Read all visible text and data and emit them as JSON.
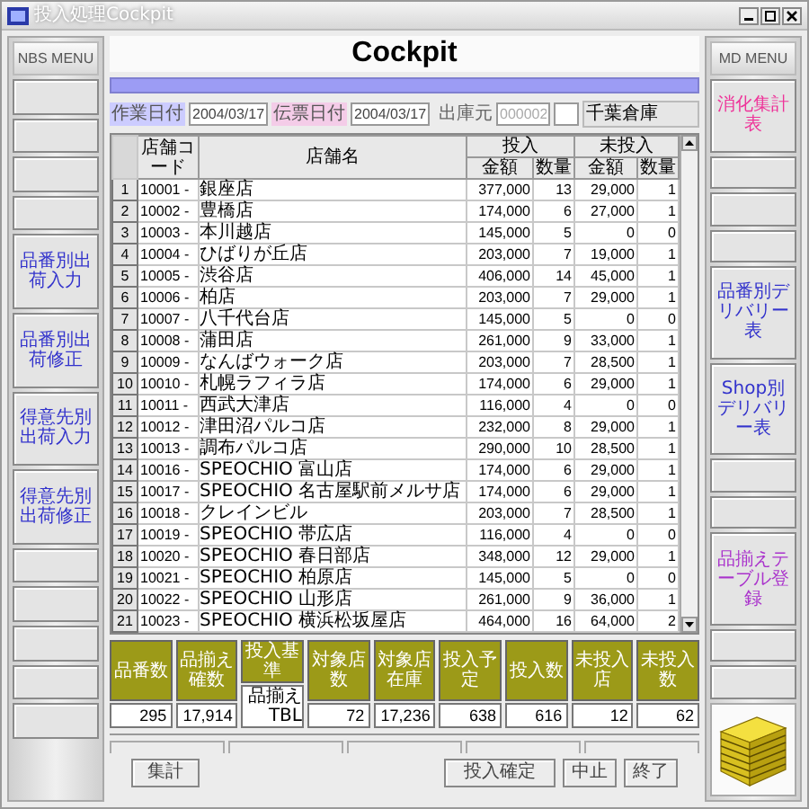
{
  "window": {
    "title": "投入処理Cockpit"
  },
  "left_menu": {
    "title": "NBS MENU",
    "items": [
      {
        "kind": "blank"
      },
      {
        "kind": "blank"
      },
      {
        "kind": "blank"
      },
      {
        "kind": "blank"
      },
      {
        "kind": "command",
        "label": "品番別出荷入力",
        "color": "#3333cc"
      },
      {
        "kind": "command",
        "label": "品番別出荷修正",
        "color": "#3333cc"
      },
      {
        "kind": "command",
        "label": "得意先別出荷入力",
        "color": "#3333cc"
      },
      {
        "kind": "command",
        "label": "得意先別出荷修正",
        "color": "#3333cc"
      },
      {
        "kind": "blank"
      },
      {
        "kind": "blank"
      },
      {
        "kind": "blank"
      },
      {
        "kind": "blank"
      },
      {
        "kind": "blank"
      }
    ]
  },
  "header": {
    "title": "Cockpit"
  },
  "fields": {
    "work_date_label": "作業日付",
    "work_date": "2004/03/17",
    "slip_date_label": "伝票日付",
    "slip_date": "2004/03/17",
    "source_label": "出庫元",
    "source_placeholder": "000002",
    "warehouse": "千葉倉庫"
  },
  "table": {
    "columns": {
      "code": "店舗コード",
      "name": "店舗名",
      "in_group": "投入",
      "out_group": "未投入",
      "in_amount": "金額",
      "in_qty": "数量",
      "out_amount": "金額",
      "out_qty": "数量"
    },
    "rows": [
      {
        "no": "1",
        "code": "10001 -",
        "name": "銀座店",
        "in_amount": "377,000",
        "in_qty": "13",
        "out_amount": "29,000",
        "out_qty": "1"
      },
      {
        "no": "2",
        "code": "10002 -",
        "name": "豊橋店",
        "in_amount": "174,000",
        "in_qty": "6",
        "out_amount": "27,000",
        "out_qty": "1"
      },
      {
        "no": "3",
        "code": "10003 -",
        "name": "本川越店",
        "in_amount": "145,000",
        "in_qty": "5",
        "out_amount": "0",
        "out_qty": "0"
      },
      {
        "no": "4",
        "code": "10004 -",
        "name": "ひばりが丘店",
        "in_amount": "203,000",
        "in_qty": "7",
        "out_amount": "19,000",
        "out_qty": "1"
      },
      {
        "no": "5",
        "code": "10005 -",
        "name": "渋谷店",
        "in_amount": "406,000",
        "in_qty": "14",
        "out_amount": "45,000",
        "out_qty": "1"
      },
      {
        "no": "6",
        "code": "10006 -",
        "name": "柏店",
        "in_amount": "203,000",
        "in_qty": "7",
        "out_amount": "29,000",
        "out_qty": "1"
      },
      {
        "no": "7",
        "code": "10007 -",
        "name": "八千代台店",
        "in_amount": "145,000",
        "in_qty": "5",
        "out_amount": "0",
        "out_qty": "0"
      },
      {
        "no": "8",
        "code": "10008 -",
        "name": "蒲田店",
        "in_amount": "261,000",
        "in_qty": "9",
        "out_amount": "33,000",
        "out_qty": "1"
      },
      {
        "no": "9",
        "code": "10009 -",
        "name": "なんばウォーク店",
        "in_amount": "203,000",
        "in_qty": "7",
        "out_amount": "28,500",
        "out_qty": "1"
      },
      {
        "no": "10",
        "code": "10010 -",
        "name": "札幌ラフィラ店",
        "in_amount": "174,000",
        "in_qty": "6",
        "out_amount": "29,000",
        "out_qty": "1"
      },
      {
        "no": "11",
        "code": "10011 -",
        "name": "西武大津店",
        "in_amount": "116,000",
        "in_qty": "4",
        "out_amount": "0",
        "out_qty": "0"
      },
      {
        "no": "12",
        "code": "10012 -",
        "name": "津田沼パルコ店",
        "in_amount": "232,000",
        "in_qty": "8",
        "out_amount": "29,000",
        "out_qty": "1"
      },
      {
        "no": "13",
        "code": "10013 -",
        "name": "調布パルコ店",
        "in_amount": "290,000",
        "in_qty": "10",
        "out_amount": "28,500",
        "out_qty": "1"
      },
      {
        "no": "14",
        "code": "10016 -",
        "name": "SPEOCHIO 富山店",
        "in_amount": "174,000",
        "in_qty": "6",
        "out_amount": "29,000",
        "out_qty": "1"
      },
      {
        "no": "15",
        "code": "10017 -",
        "name": "SPEOCHIO 名古屋駅前メルサ店",
        "in_amount": "174,000",
        "in_qty": "6",
        "out_amount": "29,000",
        "out_qty": "1"
      },
      {
        "no": "16",
        "code": "10018 -",
        "name": "クレインビル",
        "in_amount": "203,000",
        "in_qty": "7",
        "out_amount": "28,500",
        "out_qty": "1"
      },
      {
        "no": "17",
        "code": "10019 -",
        "name": "SPEOCHIO 帯広店",
        "in_amount": "116,000",
        "in_qty": "4",
        "out_amount": "0",
        "out_qty": "0"
      },
      {
        "no": "18",
        "code": "10020 -",
        "name": "SPEOCHIO 春日部店",
        "in_amount": "348,000",
        "in_qty": "12",
        "out_amount": "29,000",
        "out_qty": "1"
      },
      {
        "no": "19",
        "code": "10021 -",
        "name": "SPEOCHIO 柏原店",
        "in_amount": "145,000",
        "in_qty": "5",
        "out_amount": "0",
        "out_qty": "0"
      },
      {
        "no": "20",
        "code": "10022 -",
        "name": "SPEOCHIO 山形店",
        "in_amount": "261,000",
        "in_qty": "9",
        "out_amount": "36,000",
        "out_qty": "1"
      },
      {
        "no": "21",
        "code": "10023 -",
        "name": "SPEOCHIO 横浜松坂屋店",
        "in_amount": "464,000",
        "in_qty": "16",
        "out_amount": "64,000",
        "out_qty": "2"
      }
    ]
  },
  "summary": [
    {
      "label": "品番数",
      "value": "295",
      "kind": "number"
    },
    {
      "label": "品揃え確数",
      "value": "17,914",
      "kind": "number"
    },
    {
      "label": "投入基準",
      "value": "品揃えTBL",
      "kind": "text"
    },
    {
      "label": "対象店数",
      "value": "72",
      "kind": "number"
    },
    {
      "label": "対象店在庫",
      "value": "17,236",
      "kind": "number"
    },
    {
      "label": "投入予定",
      "value": "638",
      "kind": "number"
    },
    {
      "label": "投入数",
      "value": "616",
      "kind": "number"
    },
    {
      "label": "未投入店",
      "value": "12",
      "kind": "number"
    },
    {
      "label": "未投入数",
      "value": "62",
      "kind": "number"
    }
  ],
  "buttons": {
    "total": "集計",
    "confirm": "投入確定",
    "cancel": "中止",
    "exit": "終了"
  },
  "right_menu": {
    "title": "MD MENU",
    "items": [
      {
        "kind": "command",
        "label": "消化集計表",
        "color": "#ee3399"
      },
      {
        "kind": "blank"
      },
      {
        "kind": "blank"
      },
      {
        "kind": "blank"
      },
      {
        "kind": "command",
        "label": "品番別デリバリー表",
        "color": "#3333cc"
      },
      {
        "kind": "command",
        "label": "Shop別デリバリー表",
        "color": "#3333cc"
      },
      {
        "kind": "blank"
      },
      {
        "kind": "blank"
      },
      {
        "kind": "command",
        "label": "品揃えテーブル登録",
        "color": "#aa33cc"
      },
      {
        "kind": "blank"
      },
      {
        "kind": "blank"
      }
    ]
  }
}
